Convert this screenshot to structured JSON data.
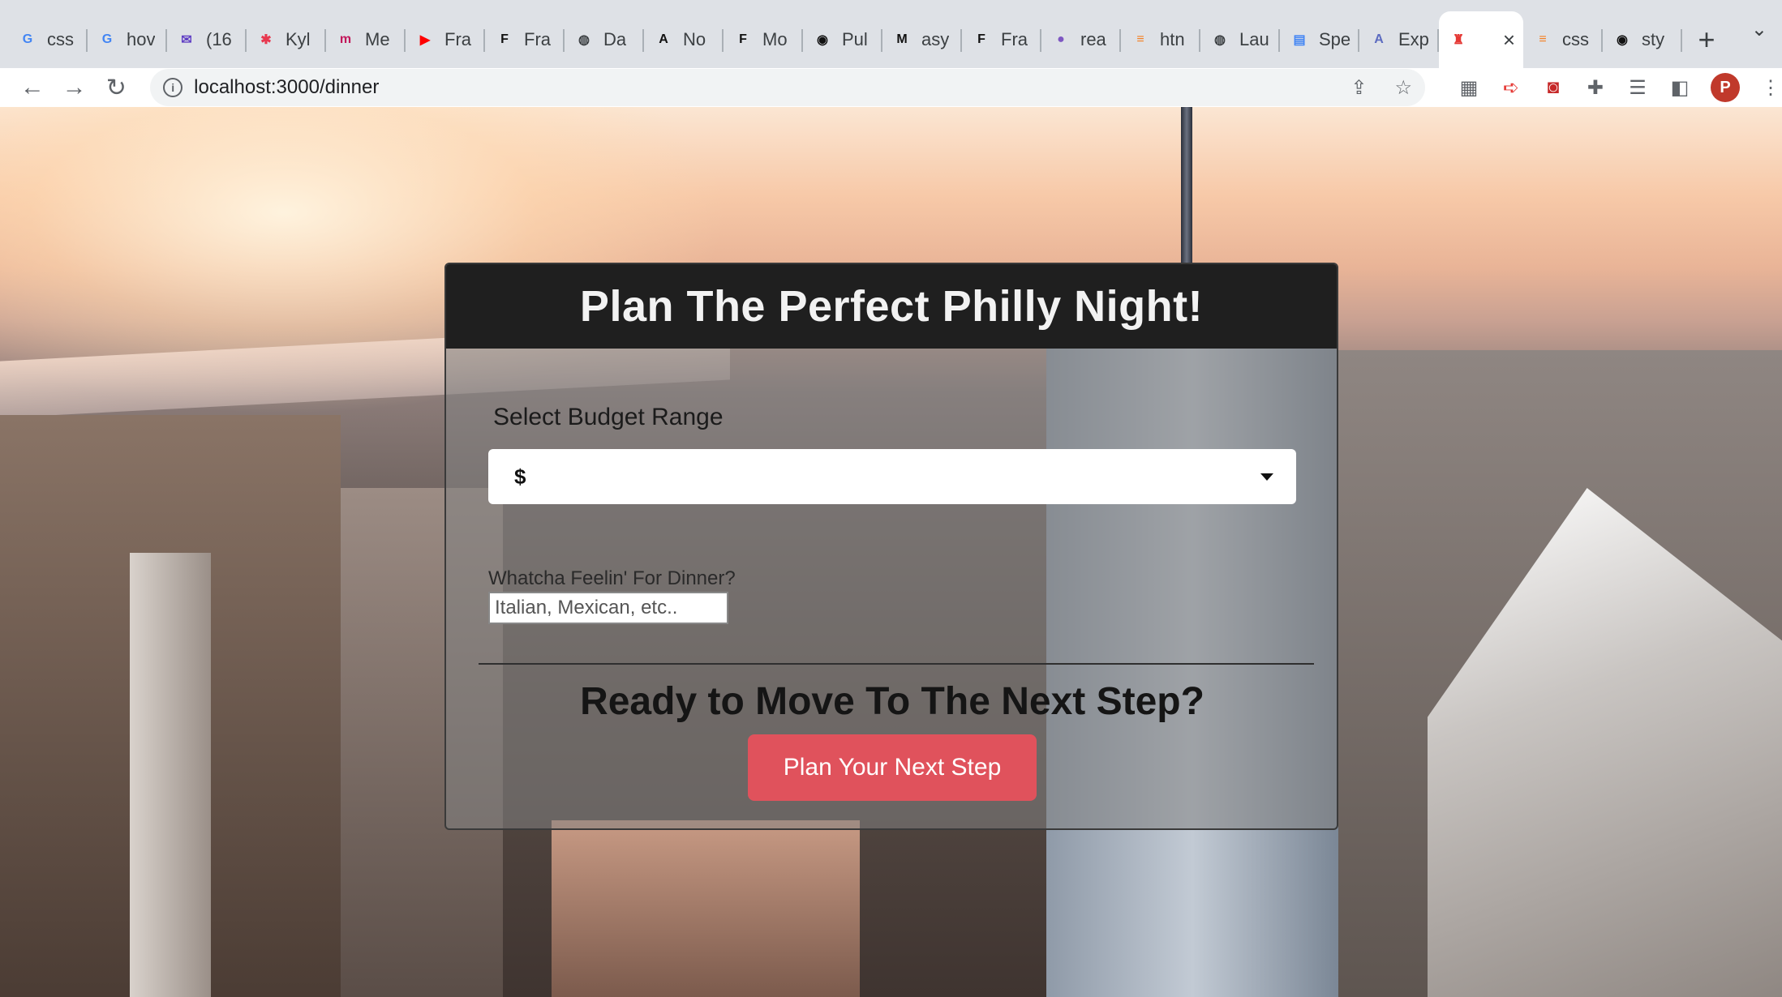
{
  "browser": {
    "tabs": [
      {
        "title": "css",
        "icon": "google-icon",
        "glyph": "G",
        "color": "#4285f4"
      },
      {
        "title": "hov",
        "icon": "google-icon",
        "glyph": "G",
        "color": "#4285f4"
      },
      {
        "title": "(16",
        "icon": "mail-icon",
        "glyph": "✉",
        "color": "#5f3dc4"
      },
      {
        "title": "Kyl",
        "icon": "asterisk-icon",
        "glyph": "✱",
        "color": "#e8384f"
      },
      {
        "title": "Me",
        "icon": "m-logo-icon",
        "glyph": "m",
        "color": "#c2185b"
      },
      {
        "title": "Fra",
        "icon": "youtube-icon",
        "glyph": "▶",
        "color": "#ff0000"
      },
      {
        "title": "Fra",
        "icon": "framer-icon",
        "glyph": "F",
        "color": "#111111"
      },
      {
        "title": "Da",
        "icon": "globe-icon",
        "glyph": "◍",
        "color": "#3c4043"
      },
      {
        "title": "No",
        "icon": "a-square-icon",
        "glyph": "A",
        "color": "#111111"
      },
      {
        "title": "Mo",
        "icon": "framer-icon",
        "glyph": "F",
        "color": "#111111"
      },
      {
        "title": "Pul",
        "icon": "github-icon",
        "glyph": "◉",
        "color": "#111111"
      },
      {
        "title": "asy",
        "icon": "m-square-icon",
        "glyph": "M",
        "color": "#111111"
      },
      {
        "title": "Fra",
        "icon": "framer-icon",
        "glyph": "F",
        "color": "#111111"
      },
      {
        "title": "rea",
        "icon": "purple-circle-icon",
        "glyph": "●",
        "color": "#7e57c2"
      },
      {
        "title": "htn",
        "icon": "stackoverflow-icon",
        "glyph": "≡",
        "color": "#f48024"
      },
      {
        "title": "Lau",
        "icon": "globe-icon",
        "glyph": "◍",
        "color": "#3c4043"
      },
      {
        "title": "Spe",
        "icon": "docs-icon",
        "glyph": "▤",
        "color": "#4285f4"
      },
      {
        "title": "Exp",
        "icon": "a-circle-icon",
        "glyph": "A",
        "color": "#5c6bc0"
      },
      {
        "title": "",
        "icon": "philly-bell-icon",
        "glyph": "♜",
        "color": "#e53935",
        "active": true
      },
      {
        "title": "css",
        "icon": "stackoverflow-icon",
        "glyph": "≡",
        "color": "#f48024"
      },
      {
        "title": "sty",
        "icon": "github-icon",
        "glyph": "◉",
        "color": "#111111"
      }
    ],
    "url": "localhost:3000/dinner"
  },
  "page": {
    "title": "Plan The Perfect Philly Night!",
    "budget": {
      "label": "Select Budget Range",
      "selected": "$"
    },
    "cuisine": {
      "label": "Whatcha Feelin' For Dinner?",
      "placeholder": "Italian, Mexican, etc.."
    },
    "next_step": {
      "heading": "Ready to Move To The Next Step?",
      "button_label": "Plan Your Next Step",
      "button_color": "#e0525c"
    }
  }
}
